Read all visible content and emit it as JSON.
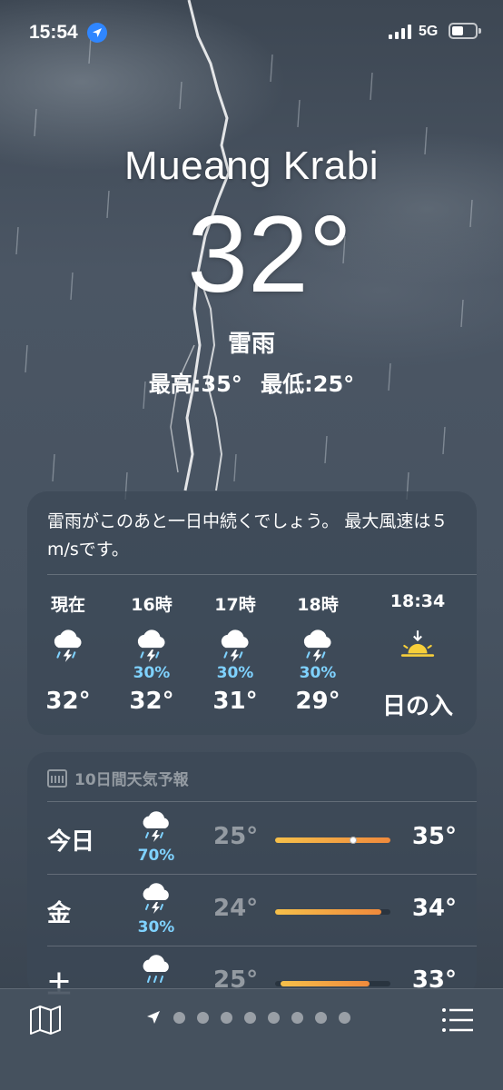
{
  "status_bar": {
    "time": "15:54",
    "network": "5G"
  },
  "weather": {
    "city": "Mueang Krabi",
    "temperature": "32°",
    "condition": "雷雨",
    "high": "最高:35°",
    "low": "最低:25°"
  },
  "hourly": {
    "summary": "雷雨がこのあと一日中続くでしょう。 最大風速は５m/sです。",
    "items": [
      {
        "label": "現在",
        "icon": "thunderstorm-icon",
        "precip": "",
        "temp": "32°"
      },
      {
        "label": "16時",
        "icon": "thunderstorm-icon",
        "precip": "30%",
        "temp": "32°"
      },
      {
        "label": "17時",
        "icon": "thunderstorm-icon",
        "precip": "30%",
        "temp": "31°"
      },
      {
        "label": "18時",
        "icon": "thunderstorm-icon",
        "precip": "30%",
        "temp": "29°"
      },
      {
        "label": "18:34",
        "icon": "sunset-icon",
        "precip": "",
        "temp": "日の入"
      }
    ]
  },
  "daily": {
    "header": "10日間天気予報",
    "items": [
      {
        "day": "今日",
        "icon": "thunderstorm-icon",
        "precip": "70%",
        "low": "25°",
        "high": "35°",
        "bar_start": 0.0,
        "bar_end": 1.0,
        "current_marker": 0.68
      },
      {
        "day": "金",
        "icon": "thunderstorm-icon",
        "precip": "30%",
        "low": "24°",
        "high": "34°",
        "bar_start": 0.0,
        "bar_end": 0.92
      },
      {
        "day": "土",
        "icon": "rain-icon",
        "precip": "",
        "low": "25°",
        "high": "33°",
        "bar_start": 0.05,
        "bar_end": 0.82
      }
    ]
  },
  "colors": {
    "precip": "#7fd2ff",
    "bar_start": "#f6c04a",
    "bar_end": "#f08a3c",
    "location_accent": "#2f86ff"
  },
  "bottom_bar": {
    "page_count": 8,
    "current_page": "location-arrow-icon"
  }
}
